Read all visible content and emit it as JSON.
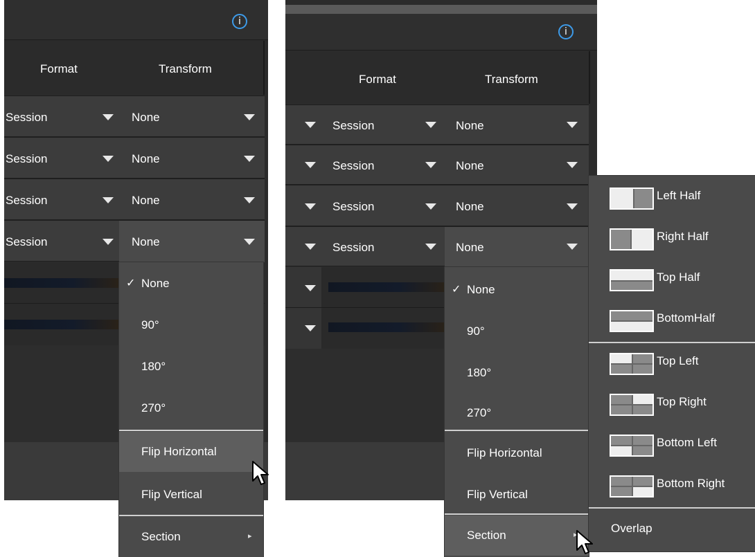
{
  "left_panel": {
    "info_glyph": "i",
    "headers": {
      "format": "Format",
      "transform": "Transform"
    },
    "rows": [
      {
        "format": "Session",
        "transform": "None"
      },
      {
        "format": "Session",
        "transform": "None"
      },
      {
        "format": "Session",
        "transform": "None"
      },
      {
        "format": "Session",
        "transform": "None"
      }
    ],
    "menu": {
      "items": [
        "None",
        "90°",
        "180°",
        "270°",
        "Flip Horizontal",
        "Flip Vertical",
        "Section"
      ],
      "checked_item": "None",
      "check_mark": "✓",
      "hovered_item": "Flip Horizontal",
      "submenu_arrow": "▸"
    }
  },
  "right_panel": {
    "info_glyph": "i",
    "headers": {
      "format": "Format",
      "transform": "Transform"
    },
    "rows": [
      {
        "format": "Session",
        "transform": "None"
      },
      {
        "format": "Session",
        "transform": "None"
      },
      {
        "format": "Session",
        "transform": "None"
      },
      {
        "format": "Session",
        "transform": "None"
      }
    ],
    "menu": {
      "items": [
        "None",
        "90°",
        "180°",
        "270°",
        "Flip Horizontal",
        "Flip Vertical",
        "Section"
      ],
      "checked_item": "None",
      "check_mark": "✓",
      "hovered_item": "Section",
      "submenu_arrow": "▸"
    },
    "section_submenu": {
      "items": [
        {
          "label": "Left Half",
          "icon": "left-half-icon"
        },
        {
          "label": "Right Half",
          "icon": "right-half-icon"
        },
        {
          "label": "Top Half",
          "icon": "top-half-icon"
        },
        {
          "label": "BottomHalf",
          "icon": "bottom-half-icon"
        },
        {
          "label": "Top Left",
          "icon": "top-left-icon"
        },
        {
          "label": "Top Right",
          "icon": "top-right-icon"
        },
        {
          "label": "Bottom Left",
          "icon": "bottom-left-icon"
        },
        {
          "label": "Bottom Right",
          "icon": "bottom-right-icon"
        },
        {
          "label": "Overlap",
          "icon": ""
        }
      ]
    }
  },
  "colors": {
    "panel_bg": "#2d2d2d",
    "row_bg": "#3c3c3c",
    "menu_bg": "#4a4a4a",
    "hover_bg": "#5e5e5e",
    "info_accent": "#3d9be9"
  }
}
